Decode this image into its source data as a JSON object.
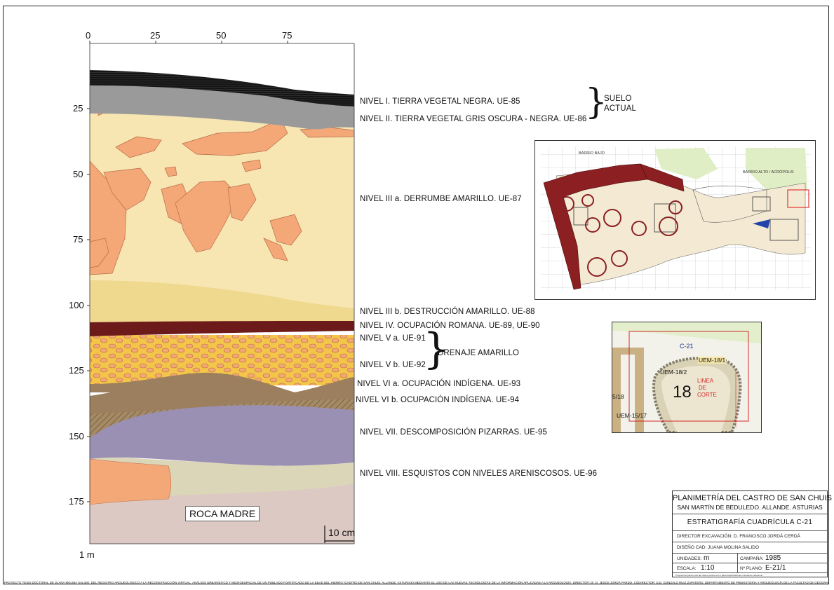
{
  "axes": {
    "x_ticks": [
      "0",
      "25",
      "50",
      "75"
    ],
    "y_ticks": [
      "25",
      "50",
      "75",
      "100",
      "125",
      "150",
      "175"
    ],
    "unit_label": "1 m",
    "scale_label": "10 cm"
  },
  "layers": {
    "nivel_1": "NIVEL I. TIERRA VEGETAL NEGRA. UE-85",
    "nivel_2": "NIVEL II. TIERRA VEGETAL GRIS OSCURA - NEGRA. UE-86",
    "suelo_actual_1": "SUELO",
    "suelo_actual_2": "ACTUAL",
    "nivel_3a": "NIVEL III a. DERRUMBE AMARILLO. UE-87",
    "nivel_3b": "NIVEL III b. DESTRUCCIÓN AMARILLO. UE-88",
    "nivel_4": "NIVEL IV. OCUPACIÓN ROMANA. UE-89, UE-90",
    "nivel_5a": "NIVEL V a. UE-91",
    "nivel_5b": "NIVEL V b. UE-92",
    "drenaje": "DRENAJE AMARILLO",
    "nivel_6a": "NIVEL VI a. OCUPACIÓN INDÍGENA. UE-93",
    "nivel_6b": "NIVEL VI b. OCUPACIÓN INDÍGENA. UE-94",
    "nivel_7": "NIVEL VII. DESCOMPOSICIÓN PIZARRAS. UE-95",
    "nivel_8": "NIVEL VIII. ESQUISTOS CON NIVELES ARENISCOSOS. UE-96",
    "roca_madre": "ROCA MADRE"
  },
  "site_map": {
    "barrio_bajo": "BARRIO BAJO",
    "barrio_alto": "BARRIO ALTO / ACRÓPOLIS"
  },
  "detail_map": {
    "grid_label": "C-21",
    "uem_18_1": "UEM-18/1",
    "uem_18_2": "UEM-18/2",
    "uem_15_17": "UEM-15/17",
    "left_label": "5/18",
    "big_number": "18",
    "linea_1": "LINEA",
    "linea_2": "DE",
    "linea_3": "CORTE"
  },
  "title_block": {
    "title": "PLANIMETRÍA DEL CASTRO DE SAN CHUIS",
    "subtitle": "SAN MARTÍN DE BEDULEDO. ALLANDE. ASTURIAS",
    "sheet_title": "ESTRATIGRAFÍA CUADRÍCULA C-21",
    "director": "DIRECTOR EXCAVACIÓN: D. FRANCISCO JORDÁ CERDÁ",
    "diseno": "DISEÑO CAD: JUANA MOLINA SALIDO",
    "unidades_label": "UNIDADES:",
    "unidades_value": "m",
    "campana_label": "CAMPAÑA:",
    "campana_value": "1985",
    "escala_label": "ESCALA:",
    "escala_value": "1:10",
    "plano_label": "Nº PLANO:",
    "plano_value": "E-21/1",
    "tiny_note": "Proyecto fiel para el uso del mismo para el uso o para especificaciones mismas de referencia"
  },
  "footer_text": "PROYECTO TESIS DOCTORAL DE JUANA MOLINA SALIDO. DEL REGISTRO ARQUEOLÓGICO A LA RECONSTRUCCIÓN VIRTUAL. ANÁLISIS URBANÍSTICO Y MICROESPACIAL DE UN POBLADO FORTIFICADO DE LA EDAD DEL HIERRO (CASTRO DE SAN CHUIS, ALLANDE, ASTURIAS) MEDIANTE EL USO DE LAS NUEVAS TECNOLOGÍAS DE LA INFORMACIÓN APLICADAS A LA ARQUEOLOGÍA. DIRECTOR: Dr. D. JESÚS JORDÁ PARDO. CODIRECTOR: D.D. GONZALO RUIZ ZAPATERO. DEPARTAMENTO DE PREHISTORIA Y ARQUEOLOGÍA DE LA FACULTAD DE GEOGRAFÍA E HISTORIA DE LA UNED",
  "colors": {
    "black_soil": "#121212",
    "grey_soil": "#9a9a9a",
    "yellow_collapse": "#f7e6b2",
    "stones": "#f4a878",
    "destruction_yellow": "#efd98f",
    "roman": "#6d1a1a",
    "drain": "#f2c232",
    "indigenous": "#9c7f5e",
    "slate": "#9a90b4",
    "schist": "#dcd6b8",
    "bedrock": "#ddc9c4",
    "wall": "#8b1f22"
  }
}
